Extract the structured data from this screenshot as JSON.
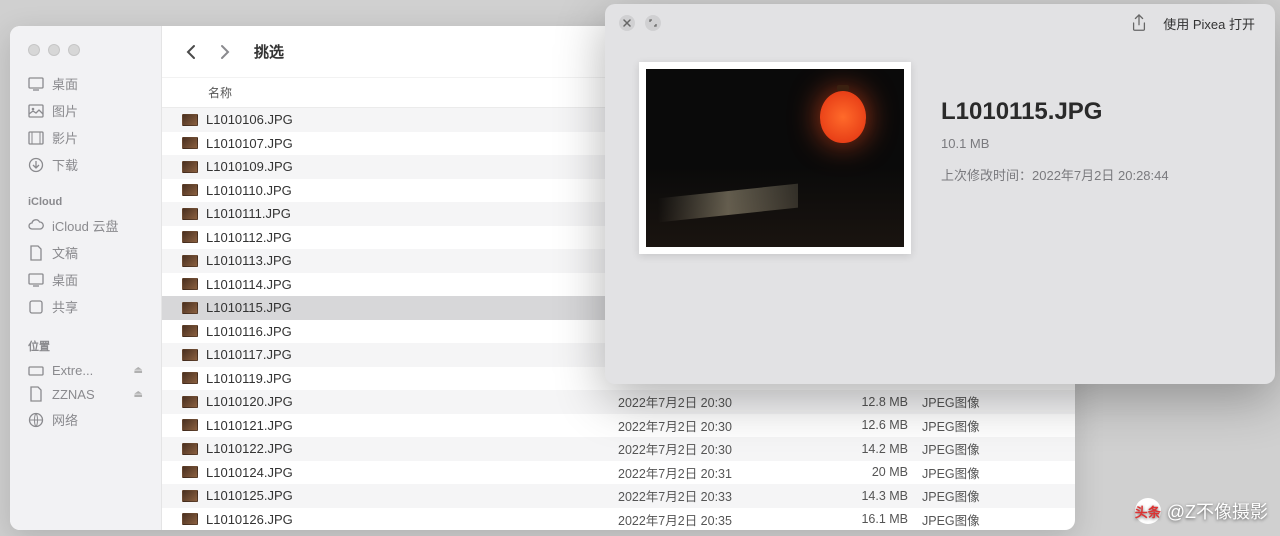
{
  "finder": {
    "folder_title": "挑选",
    "sidebar": {
      "favorites": [
        {
          "icon": "desktop",
          "label": "桌面"
        },
        {
          "icon": "image",
          "label": "图片"
        },
        {
          "icon": "movie",
          "label": "影片"
        },
        {
          "icon": "download",
          "label": "下载"
        }
      ],
      "icloud_header": "iCloud",
      "icloud": [
        {
          "icon": "cloud",
          "label": "iCloud 云盘"
        },
        {
          "icon": "doc",
          "label": "文稿"
        },
        {
          "icon": "desktop",
          "label": "桌面"
        },
        {
          "icon": "share",
          "label": "共享"
        }
      ],
      "locations_header": "位置",
      "locations": [
        {
          "icon": "disk",
          "label": "Extre...",
          "eject": true
        },
        {
          "icon": "doc",
          "label": "ZZNAS",
          "eject": true
        },
        {
          "icon": "globe",
          "label": "网络"
        }
      ]
    },
    "columns": {
      "name": "名称"
    },
    "files": [
      {
        "name": "L1010106.JPG",
        "date": "",
        "size": "",
        "kind": ""
      },
      {
        "name": "L1010107.JPG",
        "date": "",
        "size": "",
        "kind": ""
      },
      {
        "name": "L1010109.JPG",
        "date": "",
        "size": "",
        "kind": ""
      },
      {
        "name": "L1010110.JPG",
        "date": "",
        "size": "",
        "kind": ""
      },
      {
        "name": "L1010111.JPG",
        "date": "",
        "size": "",
        "kind": ""
      },
      {
        "name": "L1010112.JPG",
        "date": "",
        "size": "",
        "kind": ""
      },
      {
        "name": "L1010113.JPG",
        "date": "",
        "size": "",
        "kind": ""
      },
      {
        "name": "L1010114.JPG",
        "date": "",
        "size": "",
        "kind": ""
      },
      {
        "name": "L1010115.JPG",
        "date": "",
        "size": "",
        "kind": "",
        "selected": true
      },
      {
        "name": "L1010116.JPG",
        "date": "",
        "size": "",
        "kind": ""
      },
      {
        "name": "L1010117.JPG",
        "date": "",
        "size": "",
        "kind": ""
      },
      {
        "name": "L1010119.JPG",
        "date": "",
        "size": "",
        "kind": ""
      },
      {
        "name": "L1010120.JPG",
        "date": "2022年7月2日 20:30",
        "size": "12.8 MB",
        "kind": "JPEG图像"
      },
      {
        "name": "L1010121.JPG",
        "date": "2022年7月2日 20:30",
        "size": "12.6 MB",
        "kind": "JPEG图像"
      },
      {
        "name": "L1010122.JPG",
        "date": "2022年7月2日 20:30",
        "size": "14.2 MB",
        "kind": "JPEG图像"
      },
      {
        "name": "L1010124.JPG",
        "date": "2022年7月2日 20:31",
        "size": "20 MB",
        "kind": "JPEG图像"
      },
      {
        "name": "L1010125.JPG",
        "date": "2022年7月2日 20:33",
        "size": "14.3 MB",
        "kind": "JPEG图像"
      },
      {
        "name": "L1010126.JPG",
        "date": "2022年7月2日 20:35",
        "size": "16.1 MB",
        "kind": "JPEG图像"
      }
    ]
  },
  "quicklook": {
    "open_label": "使用 Pixea 打开",
    "title": "L1010115.JPG",
    "size": "10.1 MB",
    "meta_label": "上次修改时间：",
    "meta_value": "2022年7月2日 20:28:44"
  },
  "watermark": {
    "prefix": "头条",
    "text": "@Z不像摄影"
  }
}
